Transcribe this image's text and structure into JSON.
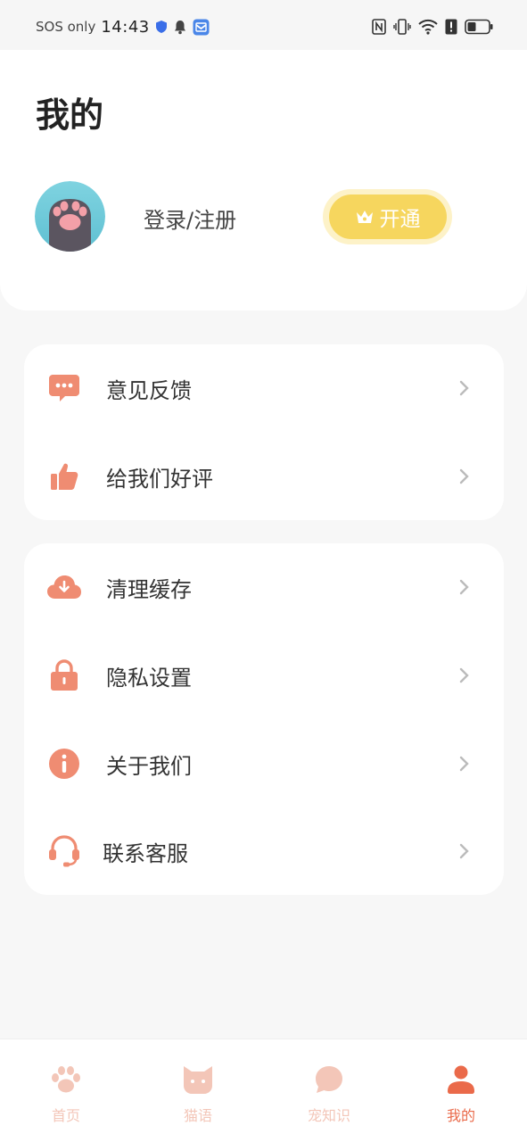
{
  "status_bar": {
    "carrier": "SOS only",
    "time": "14:43",
    "icons": [
      "shield-icon",
      "bell-icon",
      "app-notification-icon",
      "nfc-icon",
      "vibrate-icon",
      "wifi-icon",
      "alert-icon",
      "battery-icon"
    ]
  },
  "header": {
    "title": "我的",
    "login_text": "登录/注册",
    "vip_button_label": "开通",
    "avatar_icon": "cat-paw-avatar"
  },
  "menu_group_1": {
    "items": [
      {
        "label": "意见反馈",
        "icon": "feedback-chat-icon"
      },
      {
        "label": "给我们好评",
        "icon": "thumbs-up-icon"
      }
    ]
  },
  "menu_group_2": {
    "items": [
      {
        "label": "清理缓存",
        "icon": "cloud-download-icon"
      },
      {
        "label": "隐私设置",
        "icon": "lock-icon"
      },
      {
        "label": "关于我们",
        "icon": "info-icon"
      },
      {
        "label": "联系客服",
        "icon": "headset-icon"
      }
    ]
  },
  "tab_bar": {
    "tabs": [
      {
        "label": "首页",
        "icon": "paw-icon",
        "active": false
      },
      {
        "label": "猫语",
        "icon": "cat-face-icon",
        "active": false
      },
      {
        "label": "宠知识",
        "icon": "chat-bubble-icon",
        "active": false
      },
      {
        "label": "我的",
        "icon": "person-icon",
        "active": true
      }
    ]
  },
  "colors": {
    "accent": "#ea6a4a",
    "icon": "#ef8c72",
    "icon_inactive": "#f3c6b8",
    "vip_gold": "#f6d65e",
    "background": "#f7f7f7"
  }
}
